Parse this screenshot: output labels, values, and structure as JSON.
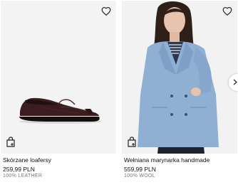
{
  "products": [
    {
      "name": "Skórzane loafersy",
      "price": "259,99 PLN",
      "material": "100% LEATHER",
      "image": "brown-leather-loafer-photo"
    },
    {
      "name": "Wełniana marynarka handmade",
      "price": "559,99 PLN",
      "material": "100% WOOL",
      "image": "light-blue-wool-blazer-model-photo"
    }
  ],
  "icons": {
    "favorite": "heart-icon",
    "bag": "shopping-bag-icon",
    "next": "chevron-right-icon"
  },
  "colors": {
    "background": "#ffffff",
    "image_background": "#f3f3f3",
    "text": "#111111",
    "muted_text": "#777777"
  }
}
